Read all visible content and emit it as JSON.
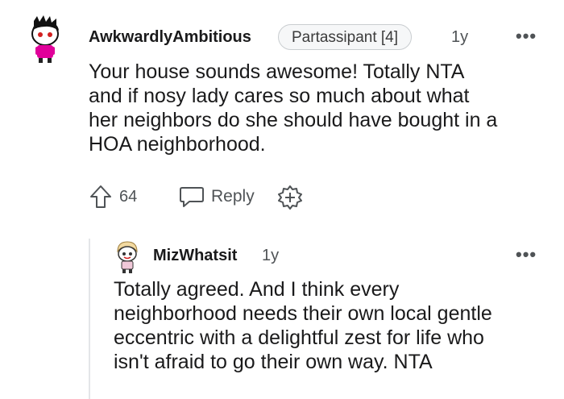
{
  "comment": {
    "username": "AwkwardlyAmbitious",
    "flair": "Partassipant [4]",
    "age": "1y",
    "more": "•••",
    "body_lines": [
      "Your house sounds awesome! Totally NTA",
      "and if nosy lady cares so much about what",
      "her neighbors do she should have bought in a",
      "HOA neighborhood."
    ],
    "score": "64",
    "reply_label": "Reply",
    "icons": {
      "avatar": "avatar-icon",
      "upvote": "upvote-arrow-icon",
      "reply": "speech-bubble-icon",
      "award": "award-plus-icon"
    }
  },
  "reply": {
    "username": "MizWhatsit",
    "age": "1y",
    "more": "•••",
    "body_lines": [
      "Totally agreed. And I think every",
      "neighborhood needs their own local gentle",
      "eccentric with a delightful zest for life who",
      "isn't afraid to go their own way. NTA"
    ]
  },
  "colors": {
    "text": "#1a1a1b",
    "meta": "#4f5356",
    "flair_bg": "#f6f7f8",
    "avatar_accent": "#e0009a",
    "thread_line": "#e4e6e8"
  }
}
